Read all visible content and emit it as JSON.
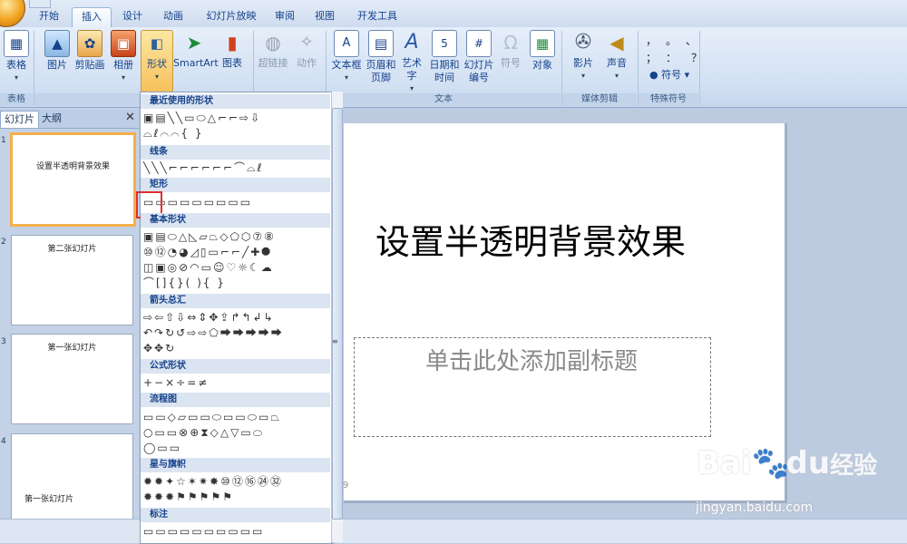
{
  "ribbon_tabs": [
    "开始",
    "插入",
    "设计",
    "动画",
    "幻灯片放映",
    "审阅",
    "视图",
    "开发工具"
  ],
  "active_tab": "插入",
  "groups": {
    "tables": {
      "label": "表格",
      "buttons": [
        {
          "label": "表格",
          "icon": "table-icon"
        }
      ]
    },
    "illustrations": {
      "label": "插",
      "buttons": [
        {
          "label": "图片",
          "icon": "picture-icon"
        },
        {
          "label": "剪贴画",
          "icon": "clipart-icon"
        },
        {
          "label": "相册",
          "icon": "photo-album-icon"
        },
        {
          "label": "形状",
          "icon": "shapes-icon"
        },
        {
          "label": "SmartArt",
          "icon": "smartart-icon"
        },
        {
          "label": "图表",
          "icon": "chart-icon"
        }
      ]
    },
    "links": {
      "buttons": [
        {
          "label": "超链接",
          "icon": "hyperlink-icon"
        },
        {
          "label": "动作",
          "icon": "action-icon"
        }
      ]
    },
    "text": {
      "label": "文本",
      "buttons": [
        {
          "label": "文本框",
          "icon": "textbox-icon"
        },
        {
          "label": "页眉和\n页脚",
          "icon": "header-footer-icon"
        },
        {
          "label": "艺术字",
          "icon": "wordart-icon"
        },
        {
          "label": "日期和\n时间",
          "icon": "date-time-icon"
        },
        {
          "label": "幻灯片\n编号",
          "icon": "slide-number-icon"
        },
        {
          "label": "符号",
          "icon": "symbol-icon"
        },
        {
          "label": "对象",
          "icon": "object-icon"
        }
      ]
    },
    "media": {
      "label": "媒体剪辑",
      "buttons": [
        {
          "label": "影片",
          "icon": "movie-icon"
        },
        {
          "label": "声音",
          "icon": "sound-icon"
        }
      ]
    },
    "special_symbols": {
      "label": "特殊符号",
      "symbols_row1": "，。、",
      "symbols_row2": "；：？",
      "symbol_button": "符号"
    }
  },
  "left_panel": {
    "tabs": [
      "幻灯片",
      "大纲"
    ],
    "slides": [
      {
        "num": "1",
        "text": "设置半透明背景效果"
      },
      {
        "num": "2",
        "text": "第二张幻灯片"
      },
      {
        "num": "3",
        "text": "第一张幻灯片"
      },
      {
        "num": "4",
        "text": "第一张幻灯片"
      }
    ]
  },
  "slide": {
    "title": "设置半透明背景效果",
    "subtitle_placeholder": "单击此处添加副标题",
    "page_mark": "9"
  },
  "shapes_gallery": {
    "sections": [
      {
        "title": "最近使用的形状",
        "rows": [
          "▣▤╲╲▭⬭△⌐⌐⇨⇩",
          "⌓ℓ⌒⌒{ }"
        ]
      },
      {
        "title": "线条",
        "rows": [
          "╲╲╲⌐⌐⌐⌐⌐⌐⌒⌓ℓ"
        ]
      },
      {
        "title": "矩形",
        "rows": [
          "▭▭▭▭▭▭▭▭▭"
        ]
      },
      {
        "title": "基本形状",
        "rows": [
          "▣▤⬭△◺▱⏢◇⬠⬡⑦⑧",
          "⑩⑫◔◕◿▯▭⌐⌐╱✚⯃",
          "◫▣◎⊘◠▭☺♡☼☾☁",
          "⌒[]{}( ){ }"
        ]
      },
      {
        "title": "箭头总汇",
        "rows": [
          "⇨⇦⇧⇩⇔⇕✥⇪↱↰↲↳",
          "↶↷↻↺⇨⇨⬠⮕⮕⮕⮕⮕",
          "✥✥↻"
        ]
      },
      {
        "title": "公式形状",
        "rows": [
          "+−×÷=≠"
        ]
      },
      {
        "title": "流程图",
        "rows": [
          "▭▭◇▱▭▭⬭▭▭⬭▭⏢",
          "○▭▭⊗⊕⧗◇△▽▭⬭",
          "◯▭▭"
        ]
      },
      {
        "title": "星与旗帜",
        "rows": [
          "✹✹✦☆✶✷✸⑩⑫⑯㉔㉜",
          "✹✹✹⚑⚑⚑⚑⚑"
        ]
      },
      {
        "title": "标注",
        "rows": [
          "▭▭▭▭▭▭▭▭▭▭"
        ]
      }
    ]
  },
  "watermark": {
    "brand": "Bai",
    "brand2": "du",
    "brand3": "经验",
    "url": "jingyan.baidu.com"
  },
  "colors": {
    "accent": "#f4b04b",
    "selection_red": "#e03030",
    "ribbon_bg": "#d3e1f3"
  }
}
